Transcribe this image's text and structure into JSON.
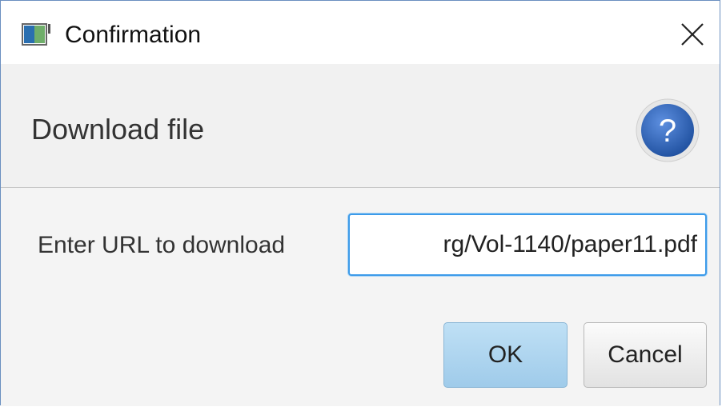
{
  "window": {
    "title": "Confirmation"
  },
  "header": {
    "text": "Download file",
    "icon": "help-icon"
  },
  "form": {
    "label": "Enter URL to download",
    "url_value": "rg/Vol-1140/paper11.pdf"
  },
  "buttons": {
    "ok_label": "OK",
    "cancel_label": "Cancel"
  },
  "colors": {
    "accent": "#3d9be9",
    "help_icon": "#2f66b8",
    "ok_button": "#b3d8f1"
  }
}
